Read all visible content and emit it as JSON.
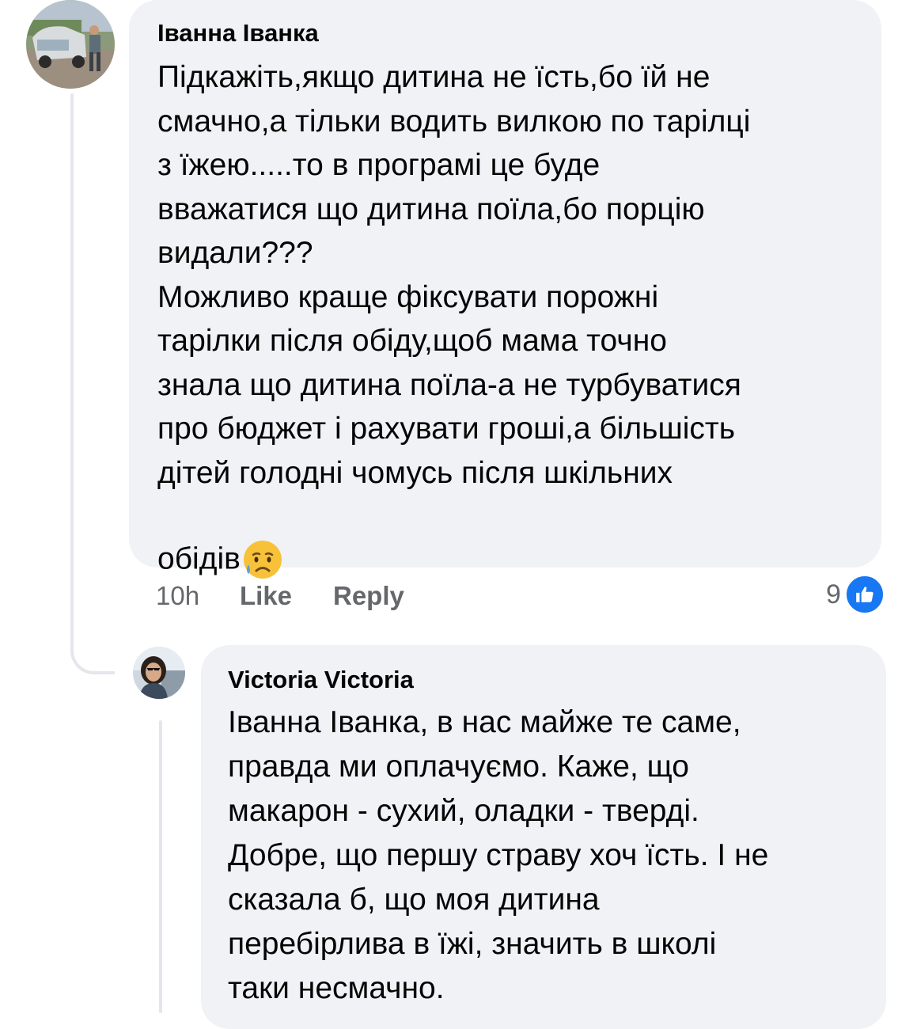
{
  "comments": [
    {
      "author": "Іванна Іванка",
      "text": "Підкажіть,якщо дитина не їсть,бо їй не\nсмачно,а тільки водить вилкою по тарілці\nз їжею.....то в програмі це буде\nвважатися що дитина поїла,бо порцію\nвидали???\nМожливо краще фіксувати порожні\nтарілки після обіду,щоб мама точно\nзнала що дитина поїла-а не турбуватися\nпро бюджет і рахувати гроші,а більшість\nдітей голодні чомусь після шкільних\nобідів",
      "emoji": "sad-but-relieved-face",
      "time": "10h",
      "like_label": "Like",
      "reply_label": "Reply",
      "reaction_count": "9",
      "reaction_icon": "thumbs-up-icon",
      "accent": "#1877f2"
    },
    {
      "author": "Victoria Victoria",
      "text": "Іванна Іванка, в нас майже те саме,\nправда ми оплачуємо. Каже, що\nмакарон  - сухий, оладки - тверді.\nДобре, що першу страву хоч їсть. І не\nсказала б, що моя дитина\nперебірлива в їжі, значить в школі\nтаки несмачно."
    }
  ]
}
